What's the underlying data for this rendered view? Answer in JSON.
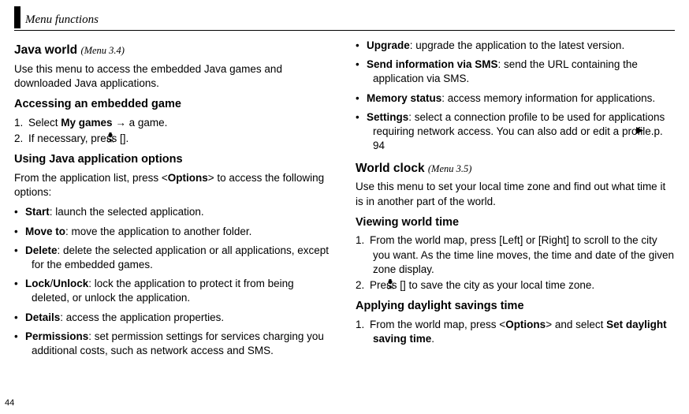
{
  "header": {
    "title": "Menu functions"
  },
  "pageNumber": "44",
  "left": {
    "sec1": {
      "title": "Java world",
      "menu": "(Menu 3.4)",
      "intro": "Use this menu to access the embedded Java games and downloaded Java applications."
    },
    "sub1": {
      "heading": "Accessing an embedded game",
      "step1_pre": "Select ",
      "step1_bold": "My games",
      "step1_post": " → a game.",
      "step2_pre": "If necessary, press [",
      "step2_post": "]."
    },
    "sub2": {
      "heading": "Using Java application options",
      "intro_pre": "From the application list, press <",
      "intro_bold": "Options",
      "intro_post": "> to access the following options:",
      "items": [
        {
          "term": "Start",
          "desc": ": launch the selected application."
        },
        {
          "term": "Move to",
          "desc": ": move the application to another folder."
        },
        {
          "term": "Delete",
          "desc": ": delete the selected application or all applications, except for the embedded games."
        },
        {
          "term": "Lock",
          "sep": "/",
          "term2": "Unlock",
          "desc": ": lock the application to protect it from being deleted, or unlock the application."
        },
        {
          "term": "Details",
          "desc": ": access the application properties."
        },
        {
          "term": "Permissions",
          "desc": ": set permission settings for services charging you additional costs, such as network access and SMS."
        }
      ]
    }
  },
  "right": {
    "contItems": [
      {
        "term": "Upgrade",
        "desc": ": upgrade the application to the latest version."
      },
      {
        "term": "Send information via SMS",
        "desc": ": send the URL containing the application via SMS."
      },
      {
        "term": "Memory status",
        "desc": ": access memory information for applications."
      },
      {
        "term": "Settings",
        "desc": ": select a connection profile to be used for applications requiring network access. You can also add or edit a profile.",
        "ref": "p. 94"
      }
    ],
    "sec2": {
      "title": "World clock",
      "menu": "(Menu 3.5)",
      "intro": "Use this menu to set your local time zone and find out what time it is in another part of the world."
    },
    "sub3": {
      "heading": "Viewing world time",
      "step1": "From the world map, press [Left] or [Right] to scroll to the city you want. As the time line moves, the time and date of the given zone display.",
      "step2_pre": "Press [",
      "step2_post": "] to save the city as your local time zone."
    },
    "sub4": {
      "heading": "Applying daylight savings time",
      "step1_pre": "From the world map, press <",
      "step1_bold1": "Options",
      "step1_mid": "> and select ",
      "step1_bold2": "Set daylight saving time",
      "step1_post": "."
    }
  }
}
